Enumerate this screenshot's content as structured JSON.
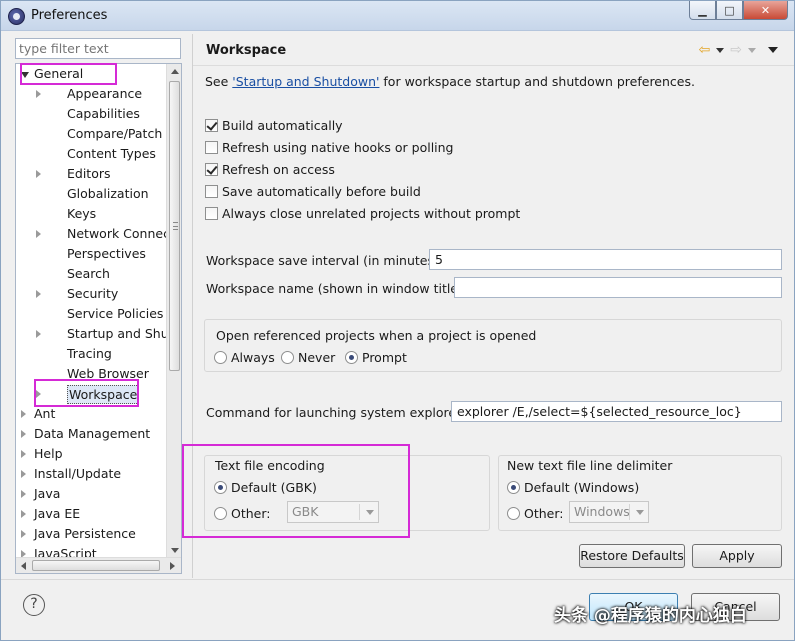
{
  "window": {
    "title": "Preferences"
  },
  "filter": {
    "placeholder": "type filter text"
  },
  "tree": {
    "items": [
      {
        "label": "General",
        "expanded": true
      },
      {
        "label": "Appearance"
      },
      {
        "label": "Capabilities"
      },
      {
        "label": "Compare/Patch"
      },
      {
        "label": "Content Types"
      },
      {
        "label": "Editors"
      },
      {
        "label": "Globalization"
      },
      {
        "label": "Keys"
      },
      {
        "label": "Network Connecti"
      },
      {
        "label": "Perspectives"
      },
      {
        "label": "Search"
      },
      {
        "label": "Security"
      },
      {
        "label": "Service Policies"
      },
      {
        "label": "Startup and Shutd"
      },
      {
        "label": "Tracing"
      },
      {
        "label": "Web Browser"
      },
      {
        "label": "Workspace",
        "selected": true
      },
      {
        "label": "Ant"
      },
      {
        "label": "Data Management"
      },
      {
        "label": "Help"
      },
      {
        "label": "Install/Update"
      },
      {
        "label": "Java"
      },
      {
        "label": "Java EE"
      },
      {
        "label": "Java Persistence"
      },
      {
        "label": "JavaScript"
      }
    ]
  },
  "page": {
    "title": "Workspace",
    "see_prefix": "See ",
    "see_link": "'Startup and Shutdown'",
    "see_suffix": " for workspace startup and shutdown preferences.",
    "checks": [
      {
        "label": "Build automatically",
        "checked": true
      },
      {
        "label": "Refresh using native hooks or polling",
        "checked": false
      },
      {
        "label": "Refresh on access",
        "checked": true
      },
      {
        "label": "Save automatically before build",
        "checked": false
      },
      {
        "label": "Always close unrelated projects without prompt",
        "checked": false
      }
    ],
    "save_interval_label": "Workspace save interval (in minutes):",
    "save_interval_value": "5",
    "ws_name_label": "Workspace name (shown in window title):",
    "ws_name_value": "",
    "open_ref_label": "Open referenced projects when a project is opened",
    "open_ref_options": [
      "Always",
      "Never",
      "Prompt"
    ],
    "open_ref_selected": "Prompt",
    "cmd_label": "Command for launching system explorer:",
    "cmd_value": "explorer /E,/select=${selected_resource_loc}",
    "encoding_group": "Text file encoding",
    "encoding_default": "Default (GBK)",
    "encoding_other": "Other:",
    "encoding_other_value": "GBK",
    "delim_group": "New text file line delimiter",
    "delim_default": "Default (Windows)",
    "delim_other": "Other:",
    "delim_other_value": "Windows",
    "restore_defaults": "Restore Defaults",
    "apply": "Apply"
  },
  "footer": {
    "help": "?",
    "ok": "OK",
    "cancel": "Cancel"
  },
  "watermark": "头条 @程序猿的内心独白",
  "colors": {
    "highlight": "#d52ad6",
    "link": "#1a4fa3",
    "nav_arrow": "#e3a425"
  }
}
